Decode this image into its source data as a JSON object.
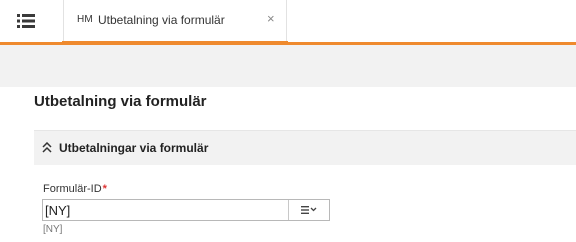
{
  "tabbar": {
    "menu_icon": "list-menu-icon",
    "active_tab": {
      "code": "HM",
      "title": "Utbetalning via formulär",
      "close_label": "×"
    }
  },
  "page": {
    "title": "Utbetalning via formulär"
  },
  "section": {
    "icon": "double-chevron-up-icon",
    "title": "Utbetalningar via formulär"
  },
  "form": {
    "formular_id": {
      "label": "Formulär-ID",
      "required_marker": "*",
      "value": "[NY]",
      "hint": "[NY]",
      "picker_icon": "list-dropdown-icon"
    }
  },
  "colors": {
    "accent": "#ef8a2e",
    "toolbar_bg": "#f2f2f2",
    "required": "#dd3333"
  }
}
